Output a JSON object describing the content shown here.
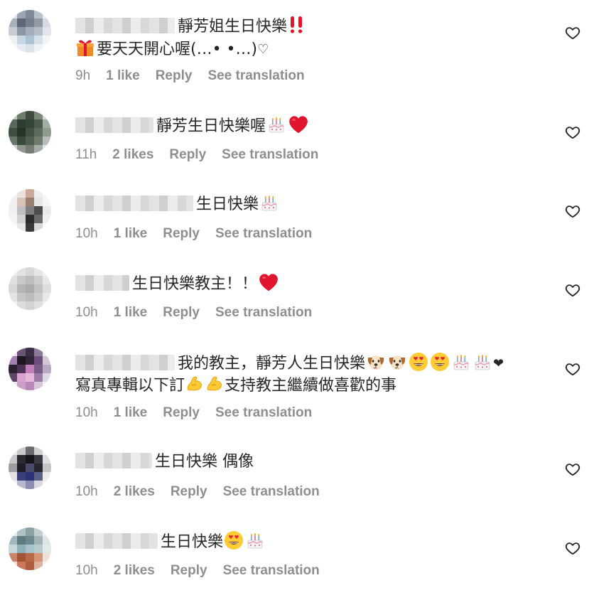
{
  "colors": {
    "text": "#262626",
    "meta": "#8e8e8e",
    "heart_outline": "#262626"
  },
  "icons": {
    "like": "heart-outline-icon",
    "cake": "birthday-cake-emoji",
    "red_heart": "red-heart-emoji",
    "heart_eyes": "heart-eyes-emoji",
    "dog": "dog-face-emoji",
    "muscle": "flexed-biceps-emoji",
    "double_exclamation": "double-exclamation-emoji",
    "gift": "wrapped-gift-emoji"
  },
  "comments": [
    {
      "line1": "靜芳姐生日快樂",
      "line2_text": "要天天開心喔(…• •…)",
      "line2_heart": "♡",
      "time": "9h",
      "likes": "1 like",
      "reply": "Reply",
      "translate": "See translation"
    },
    {
      "line1": "靜芳生日快樂喔",
      "time": "11h",
      "likes": "2 likes",
      "reply": "Reply",
      "translate": "See translation"
    },
    {
      "line1": "生日快樂",
      "time": "10h",
      "likes": "1 like",
      "reply": "Reply",
      "translate": "See translation"
    },
    {
      "line1": "生日快樂教主！！",
      "time": "10h",
      "likes": "1 like",
      "reply": "Reply",
      "translate": "See translation"
    },
    {
      "line1": "我的教主，靜芳人生日快樂",
      "line1_heart": "❤",
      "line2a": "寫真專輯以下訂",
      "line2b": "支持教主繼續做喜歡的事",
      "time": "10h",
      "likes": "1 like",
      "reply": "Reply",
      "translate": "See translation"
    },
    {
      "line1": "生日快樂 偶像",
      "time": "10h",
      "likes": "2 likes",
      "reply": "Reply",
      "translate": "See translation"
    },
    {
      "line1": "生日快樂",
      "time": "10h",
      "likes": "2 likes",
      "reply": "Reply",
      "translate": "See translation"
    }
  ]
}
